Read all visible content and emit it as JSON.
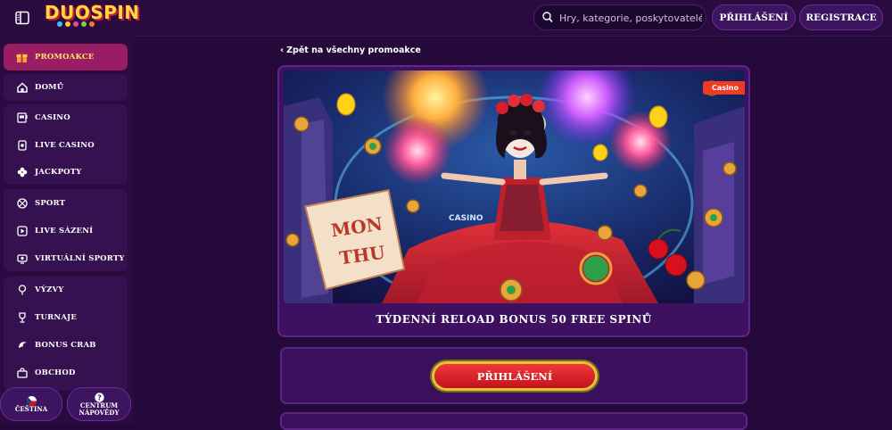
{
  "header": {
    "logo_text": "DUOSPIN",
    "search_placeholder": "Hry, kategorie, poskytovatelé",
    "login_label": "PŘIHLÁŠENÍ",
    "register_label": "REGISTRACE"
  },
  "sidebar": {
    "groups": [
      [
        {
          "label": "PROMOAKCE",
          "icon": "gift-icon"
        }
      ],
      [
        {
          "label": "DOMŮ",
          "icon": "home-icon"
        }
      ],
      [
        {
          "label": "CASINO",
          "icon": "slot-machine-icon"
        },
        {
          "label": "LIVE CASINO",
          "icon": "live-card-icon"
        },
        {
          "label": "JACKPOTY",
          "icon": "clover-icon"
        }
      ],
      [
        {
          "label": "SPORT",
          "icon": "ball-icon"
        },
        {
          "label": "LIVE SÁZENÍ",
          "icon": "play-icon"
        },
        {
          "label": "VIRTUÁLNÍ SPORTY",
          "icon": "virtual-screen-icon"
        }
      ],
      [
        {
          "label": "VÝZVY",
          "icon": "target-icon"
        },
        {
          "label": "TURNAJE",
          "icon": "trophy-icon"
        },
        {
          "label": "BONUS CRAB",
          "icon": "claw-icon"
        },
        {
          "label": "OBCHOD",
          "icon": "shop-icon"
        }
      ]
    ],
    "language_label": "ČEŠTINA",
    "help_label_line1": "CENTRUM",
    "help_label_line2": "NÁPOVĚDY"
  },
  "main": {
    "back_link": "Zpět na všechny promoakce",
    "badge": "Casino",
    "banner_text_mon": "MON",
    "banner_text_thu": "THU",
    "banner_sign": "CASINO",
    "promo_title": "TÝDENNÍ RELOAD BONUS 50 FREE SPINŮ",
    "cta_label": "PŘIHLÁŠENÍ"
  },
  "colors": {
    "background": "#25093a",
    "accent_red": "#e0252f",
    "accent_gold": "#e1c43a",
    "active_nav": "#9a1d63",
    "badge": "#ef3b24"
  }
}
